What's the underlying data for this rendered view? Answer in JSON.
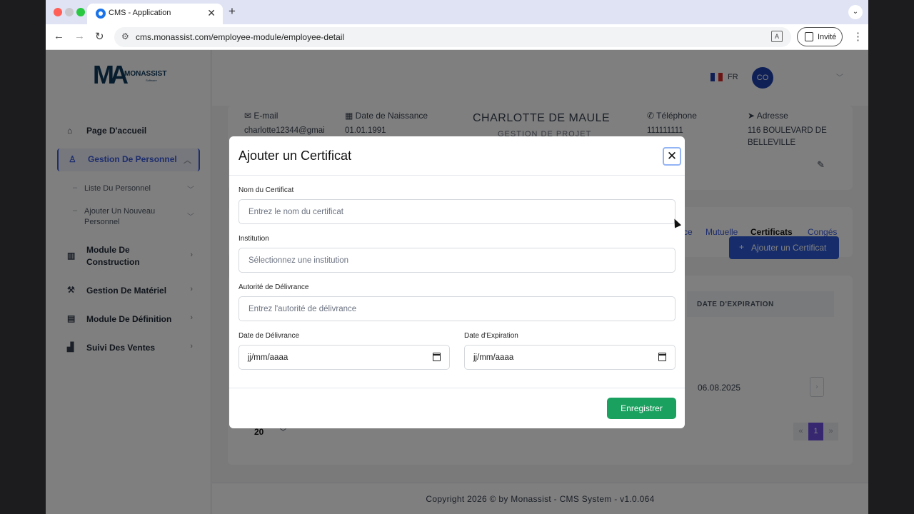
{
  "browser": {
    "tab_title": "CMS - Application",
    "url": "cms.monassist.com/employee-module/employee-detail",
    "profile_label": "Invité"
  },
  "logo": {
    "brand": "MONASSIST",
    "sub": "Software"
  },
  "sidebar": {
    "items": [
      {
        "label": "Page D'accueil",
        "icon": "home-icon"
      },
      {
        "label": "Gestion De Personnel",
        "icon": "users-icon",
        "active": true
      },
      {
        "label": "Module De Construction",
        "icon": "building-icon"
      },
      {
        "label": "Gestion De Matériel",
        "icon": "hammer-icon"
      },
      {
        "label": "Module De Définition",
        "icon": "id-card-icon"
      },
      {
        "label": "Suivi Des Ventes",
        "icon": "chart-icon"
      }
    ],
    "subitems": [
      {
        "label": "Liste Du Personnel"
      },
      {
        "label": "Ajouter Un Nouveau Personnel"
      }
    ]
  },
  "header": {
    "lang": "FR",
    "avatar": "CO"
  },
  "profile": {
    "email_label": "E-mail",
    "email_value": "charlotte12344@gmai",
    "dob_label": "Date de Naissance",
    "dob_value": "01.01.1991",
    "name": "CHARLOTTE DE MAULE",
    "role": "GESTION DE PROJET",
    "phone_label": "Téléphone",
    "phone_value": "111111111",
    "address_label": "Adresse",
    "address_line1": "116 BOULEVARD DE",
    "address_line2": "BELLEVILLE"
  },
  "tabs": {
    "partial": "ce",
    "mutuelle": "Mutuelle",
    "certificats": "Certificats",
    "conges": "Congés"
  },
  "certificates": {
    "add_button": "Ajouter un Certificat",
    "col_expiration": "DATE D'EXPIRATION",
    "row_expiration": "06.08.2025",
    "per_page": "20",
    "current_page": "1"
  },
  "footer": "Copyright 2026 © by Monassist - CMS System - v1.0.064",
  "modal": {
    "title": "Ajouter un Certificat",
    "name_label": "Nom du Certificat",
    "name_placeholder": "Entrez le nom du certificat",
    "institution_label": "Institution",
    "institution_placeholder": "Sélectionnez une institution",
    "authority_label": "Autorité de Délivrance",
    "authority_placeholder": "Entrez l'autorité de délivrance",
    "issue_label": "Date de Délivrance",
    "issue_value": "jj/mm/aaaa",
    "expiry_label": "Date d'Expiration",
    "expiry_value": "jj/mm/aaaa",
    "save_label": "Enregistrer"
  },
  "colors": {
    "accent": "#3b5bdb",
    "primary_button": "#2f5ad6",
    "save_button": "#1aa15f",
    "avatar": "#1e40af"
  }
}
